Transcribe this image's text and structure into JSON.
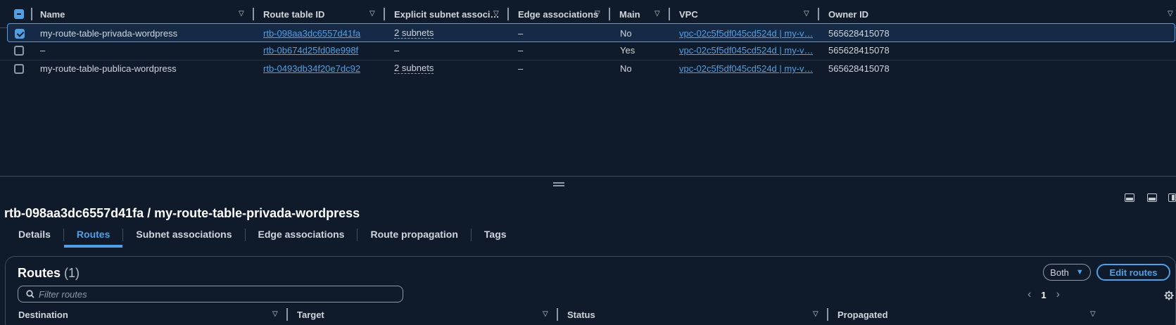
{
  "table": {
    "columns": [
      {
        "label": "Name"
      },
      {
        "label": "Route table ID"
      },
      {
        "label": "Explicit subnet associ…"
      },
      {
        "label": "Edge associations"
      },
      {
        "label": "Main"
      },
      {
        "label": "VPC"
      },
      {
        "label": "Owner ID"
      }
    ],
    "rows": [
      {
        "selected": true,
        "name": "my-route-table-privada-wordpress",
        "id": "rtb-098aa3dc6557d41fa",
        "subnets": "2 subnets",
        "edge": "–",
        "main": "No",
        "vpc": "vpc-02c5f5df045cd524d | my-v…",
        "owner": "565628415078"
      },
      {
        "selected": false,
        "name": "–",
        "id": "rtb-0b674d25fd08e998f",
        "subnets": "–",
        "edge": "–",
        "main": "Yes",
        "vpc": "vpc-02c5f5df045cd524d | my-v…",
        "owner": "565628415078"
      },
      {
        "selected": false,
        "name": "my-route-table-publica-wordpress",
        "id": "rtb-0493db34f20e7dc92",
        "subnets": "2 subnets",
        "edge": "–",
        "main": "No",
        "vpc": "vpc-02c5f5df045cd524d | my-v…",
        "owner": "565628415078"
      }
    ]
  },
  "detail": {
    "title": "rtb-098aa3dc6557d41fa / my-route-table-privada-wordpress",
    "tabs": [
      "Details",
      "Routes",
      "Subnet associations",
      "Edge associations",
      "Route propagation",
      "Tags"
    ],
    "active_tab": "Routes"
  },
  "routes": {
    "title": "Routes",
    "count": "(1)",
    "filter_placeholder": "Filter routes",
    "both_label": "Both",
    "edit_label": "Edit routes",
    "page": "1",
    "columns": [
      "Destination",
      "Target",
      "Status",
      "Propagated"
    ]
  },
  "colors": {
    "background": "#0f1b2a",
    "accent": "#539fe5",
    "selected_row": "#142a46"
  }
}
